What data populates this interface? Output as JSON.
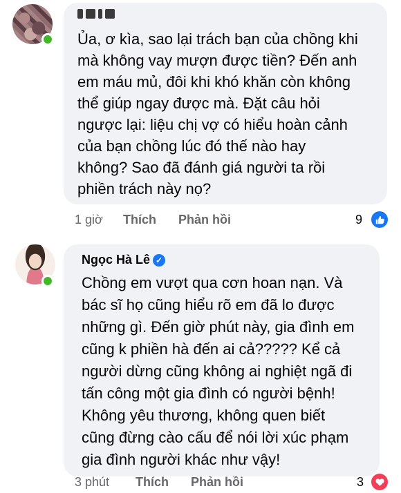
{
  "comments": [
    {
      "author": "",
      "verified": false,
      "lines": [
        "Ủa, ơ kìa, sao lại trách bạn của chồng khi",
        "mà không vay mượn được tiền? Đến anh",
        "em máu mủ, đôi khi khó khăn còn không",
        "thể giúp ngay được mà. Đặt câu hỏi",
        "ngược lại: liệu chị vợ có hiểu hoàn cảnh",
        "của bạn chồng lúc đó thế nào hay",
        "không? Sao đã đánh giá người ta rồi",
        "phiền trách này nọ?"
      ],
      "time": "1 giờ",
      "like_label": "Thích",
      "reply_label": "Phản hồi",
      "reaction_count": "9",
      "reaction_icon": "like-icon"
    },
    {
      "author": "Ngọc Hà Lê",
      "verified": true,
      "lines": [
        "Chồng em vượt qua cơn hoan nạn. Và",
        "bác sĩ họ cũng hiểu rõ em đã lo được",
        "những gì. Đến giờ phút này, gia đình em",
        "cũng k phiền hà đến ai cả????? Kể cả",
        "người dừng cũng không ai nghiệt ngã đi",
        "tấn công một gia đình có người bệnh!",
        "Không yêu thương, không quen biết",
        "cũng đừng cào cấu để nói lời xúc phạm",
        "gia đình người khác như vậy!"
      ],
      "time": "3 phút",
      "like_label": "Thích",
      "reply_label": "Phản hồi",
      "reaction_count": "3",
      "reaction_icon": "heart-icon"
    }
  ],
  "colors": {
    "bubble": "#f0f2f5",
    "meta_text": "#65676b",
    "like_blue": "#1877f2",
    "heart_red": "#f33e58",
    "online_green": "#42b72a"
  }
}
